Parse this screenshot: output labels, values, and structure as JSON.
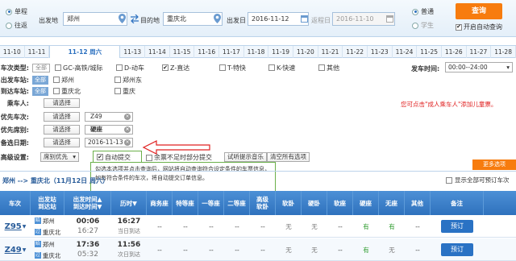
{
  "search": {
    "trip_types": [
      "单程",
      "往返"
    ],
    "from_label": "出发地",
    "from_value": "郑州",
    "to_label": "目的地",
    "to_value": "重庆北",
    "depart_label": "出发日",
    "depart_date": "2016-11-12",
    "return_label": "返程日",
    "return_date": "2016-11-10",
    "ticket_types": [
      "普通",
      "学生"
    ],
    "query_label": "查询",
    "auto_query_label": "开启自动查询"
  },
  "date_tabs": [
    "11-10",
    "11-11",
    "11-12 周六",
    "11-13",
    "11-14",
    "11-15",
    "11-16",
    "11-17",
    "11-18",
    "11-19",
    "11-20",
    "11-21",
    "11-22",
    "11-23",
    "11-24",
    "11-25",
    "11-26",
    "11-27",
    "11-28"
  ],
  "filters": {
    "train_type_label": "车次类型:",
    "all_label": "全部",
    "train_types": [
      "GC-高铁/城际",
      "D-动车",
      "Z-直达",
      "T-特快",
      "K-快速",
      "其他"
    ],
    "depart_time_label": "发车时间:",
    "depart_time_value": "00:00--24:00",
    "from_station_label": "出发车站:",
    "from_stations": [
      "郑州",
      "郑州东"
    ],
    "to_station_label": "到达车站:",
    "to_stations": [
      "重庆北",
      "重庆"
    ],
    "passenger_label": "乘车人:",
    "pick_label": "请选择",
    "child_tip": "您可点击\"成人乘车人\"添加儿童票。",
    "train_pref_label": "优先车次:",
    "train_pref_value": "Z49",
    "seat_pref_label": "优先席别:",
    "seat_pref_value": "硬座",
    "alt_date_label": "备选日期:",
    "alt_date_value": "2016-11-13",
    "advanced_label": "高级设置:",
    "seat_priority_value": "席别优先",
    "auto_submit_label": "自动提交",
    "partial_submit_label": "余票不足时部分提交",
    "try_music_label": "试听提示音乐",
    "clear_all_label": "清空所有选项",
    "more_label": "更多选项"
  },
  "tooltip": "勾选本选项并点击查询后，网站将自动查询符合设定条件的车票信息，如有符合条件的车次，将自动提交订单信息。",
  "summary": {
    "route": "郑州 --> 重庆北（11月12日 周六）",
    "show_all_label": "显示全部可预订车次"
  },
  "table": {
    "headers": [
      "车次",
      "出发站\n到达站",
      "出发时间▲\n到达时间▼",
      "历时▼",
      "商务座",
      "特等座",
      "一等座",
      "二等座",
      "高级\n软卧",
      "软卧",
      "硬卧",
      "软座",
      "硬座",
      "无座",
      "其他",
      "备注"
    ],
    "rows": [
      {
        "train": "Z95",
        "from": "郑州",
        "to": "重庆北",
        "dep": "00:06",
        "arr": "16:27",
        "dur": "16:27",
        "dur_note": "当日到达",
        "cells": [
          "--",
          "--",
          "--",
          "--",
          "--",
          "无",
          "无",
          "--",
          "有",
          "有",
          "--"
        ],
        "action": "预订"
      },
      {
        "train": "Z49",
        "from": "郑州",
        "to": "重庆北",
        "dep": "17:36",
        "arr": "05:32",
        "dur": "11:56",
        "dur_note": "次日到达",
        "cells": [
          "--",
          "--",
          "--",
          "--",
          "--",
          "无",
          "无",
          "--",
          "有",
          "无",
          "--"
        ],
        "action": "预订"
      }
    ]
  }
}
